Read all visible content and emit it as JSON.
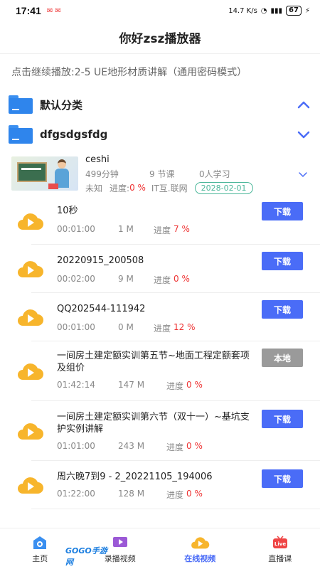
{
  "status": {
    "time": "17:41",
    "network_speed": "14.7 K/s",
    "battery": "67"
  },
  "header": {
    "title": "你好zsz播放器"
  },
  "continue_text": "点击继续播放:2-5 UE地形材质讲解（通用密码模式）",
  "categories": [
    {
      "label": "默认分类",
      "expanded": false
    },
    {
      "label": "dfgsdgsfdg",
      "expanded": true
    }
  ],
  "course": {
    "name": "ceshi",
    "minutes": "499分钟",
    "lessons_count": "9 节课",
    "learners": "0人学习",
    "status": "未知",
    "progress_label": "进度:",
    "progress_value": "0 %",
    "org": "IT互.联网",
    "date": "2028-02-01"
  },
  "lessons": [
    {
      "title": "10秒",
      "duration": "00:01:00",
      "size": "1 M",
      "progress_label": "进度",
      "progress": "7 %",
      "button": "下载",
      "button_type": "download"
    },
    {
      "title": "20220915_200508",
      "duration": "00:02:00",
      "size": "9 M",
      "progress_label": "进度",
      "progress": "0 %",
      "button": "下载",
      "button_type": "download"
    },
    {
      "title": "QQ202544-111942",
      "duration": "00:01:00",
      "size": "0 M",
      "progress_label": "进度",
      "progress": "12 %",
      "button": "下载",
      "button_type": "download"
    },
    {
      "title": "一间房土建定额实训第五节~地面工程定额套项及组价",
      "duration": "01:42:14",
      "size": "147 M",
      "progress_label": "进度",
      "progress": "0 %",
      "button": "本地",
      "button_type": "local"
    },
    {
      "title": "一间房土建定额实训第六节（双十一）~基坑支护实例讲解",
      "duration": "01:01:00",
      "size": "243 M",
      "progress_label": "进度",
      "progress": "0 %",
      "button": "下载",
      "button_type": "download"
    },
    {
      "title": "周六晚7到9 - 2_20221105_194006",
      "duration": "01:22:00",
      "size": "128 M",
      "progress_label": "进度",
      "progress": "0 %",
      "button": "下载",
      "button_type": "download"
    }
  ],
  "tabbar": [
    {
      "label": "主页",
      "icon": "home-icon"
    },
    {
      "label": "录播视频",
      "icon": "video-icon"
    },
    {
      "label": "在线视频",
      "icon": "cloud-play-icon",
      "active": true
    },
    {
      "label": "直播课",
      "icon": "live-icon"
    }
  ],
  "watermark": "GOGO手游网",
  "colors": {
    "accent": "#4a6cf7",
    "folder": "#2f85ec",
    "play_icon": "#f7b52c",
    "progress_red": "#e33333",
    "date_green": "#4cb79a",
    "local_button": "#9a9a9a"
  }
}
